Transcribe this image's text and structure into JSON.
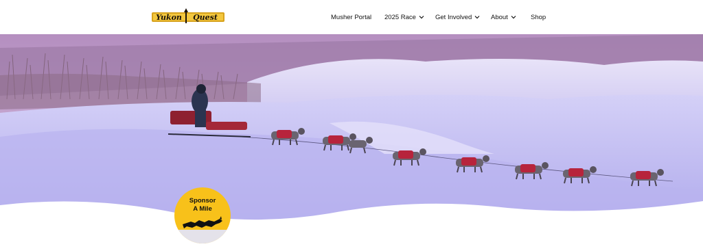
{
  "header": {
    "logo_text": "Yukon Quest",
    "nav": [
      {
        "label": "Musher Portal",
        "has_dropdown": false
      },
      {
        "label": "2025 Race",
        "has_dropdown": true
      },
      {
        "label": "Get Involved",
        "has_dropdown": true
      },
      {
        "label": "About",
        "has_dropdown": true
      },
      {
        "label": "Shop",
        "has_dropdown": false
      }
    ]
  },
  "hero": {
    "image_subject": "musher with dog sled team on snowy trail"
  },
  "sponsor": {
    "line1": "Sponsor",
    "line2": "A Mile",
    "color": "#f8c11a",
    "icon": "sled-dogs-icon"
  },
  "colors": {
    "logo_gold": "#d7a21c",
    "logo_dark": "#1a1208",
    "snow": "#c9c6f3",
    "dog_coat": "#b7243c"
  }
}
